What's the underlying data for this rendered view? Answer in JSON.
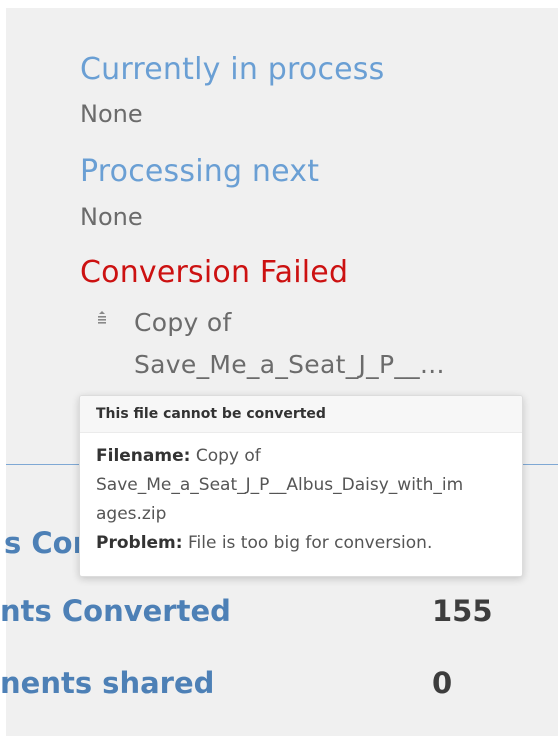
{
  "queue": {
    "current": {
      "heading": "Currently in process",
      "value": "None"
    },
    "next": {
      "heading": "Processing next",
      "value": "None"
    },
    "failed": {
      "heading": "Conversion Failed",
      "item_line1": "Copy of",
      "item_line2": "Save_Me_a_Seat_J_P__..."
    }
  },
  "tooltip": {
    "title": "This file cannot be converted",
    "filename_label": "Filename:",
    "filename_line1": "Copy of",
    "filename_line2": "Save_Me_a_Seat_J_P__Albus_Daisy_with_im",
    "filename_line3": "ages.zip",
    "problem_label": "Problem:",
    "problem_text": "File is too big for conversion."
  },
  "stats": [
    {
      "label": "s Con",
      "value": ""
    },
    {
      "label": "nts Converted",
      "value": "155"
    },
    {
      "label": "nents shared",
      "value": "0"
    }
  ],
  "colors": {
    "panel_bg": "#f0f0f0",
    "heading_blue": "#6a9fd4",
    "failed_red": "#cc1111",
    "stat_label_blue": "#4d80b6",
    "muted_text": "#6b6b6b",
    "divider": "#7fa8d4"
  },
  "icons": {
    "failed_item_icon": "list-handle-icon"
  }
}
